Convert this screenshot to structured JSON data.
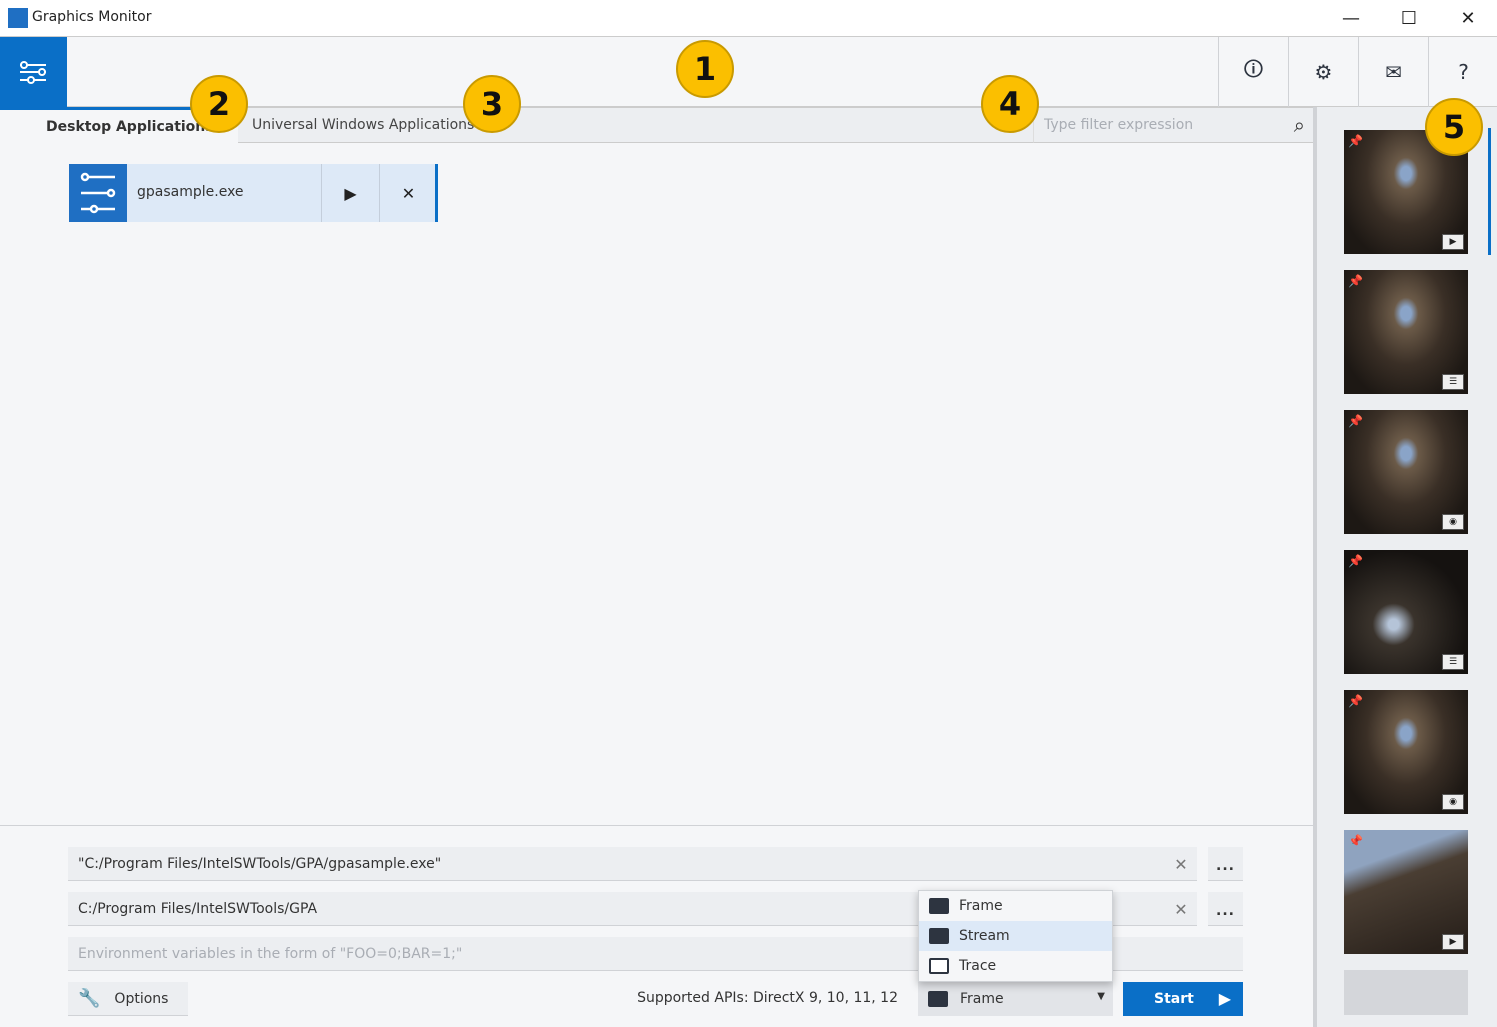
{
  "window": {
    "title": "Graphics Monitor",
    "minimize": "—",
    "maximize": "☐",
    "close": "✕"
  },
  "toolbar": {
    "info": "🛈",
    "settings": "⚙",
    "mail": "✉",
    "help": "?"
  },
  "tabs": [
    {
      "label": "Desktop Applications",
      "active": true
    },
    {
      "label": "Universal Windows Applications",
      "active": false
    }
  ],
  "filter": {
    "placeholder": "Type filter expression",
    "search_icon": "⌕"
  },
  "apps": [
    {
      "name": "gpasample.exe",
      "run": "▶",
      "remove": "✕"
    }
  ],
  "launch": {
    "path": "\"C:/Program Files/IntelSWTools/GPA/gpasample.exe\"",
    "working_dir": "C:/Program Files/IntelSWTools/GPA",
    "env_placeholder": "Environment variables in the form of \"FOO=0;BAR=1;\"",
    "browse": "...",
    "clear": "✕",
    "options": "Options",
    "supported_apis": "Supported APIs: DirectX 9, 10, 11, 12",
    "mode": "Frame",
    "start": "Start"
  },
  "mode_menu": [
    {
      "label": "Frame"
    },
    {
      "label": "Stream",
      "highlighted": true
    },
    {
      "label": "Trace"
    }
  ],
  "thumbnails": [
    {
      "type": "stream",
      "badge": "▶"
    },
    {
      "type": "trace",
      "badge": "☰"
    },
    {
      "type": "frame",
      "badge": "◉"
    },
    {
      "type": "trace",
      "badge": "☰"
    },
    {
      "type": "frame",
      "badge": "◉"
    },
    {
      "type": "stream",
      "badge": "▶"
    }
  ],
  "callouts": [
    "1",
    "2",
    "3",
    "4",
    "5"
  ],
  "colors": {
    "accent": "#0a6fc7",
    "callout": "#fbbf00"
  }
}
